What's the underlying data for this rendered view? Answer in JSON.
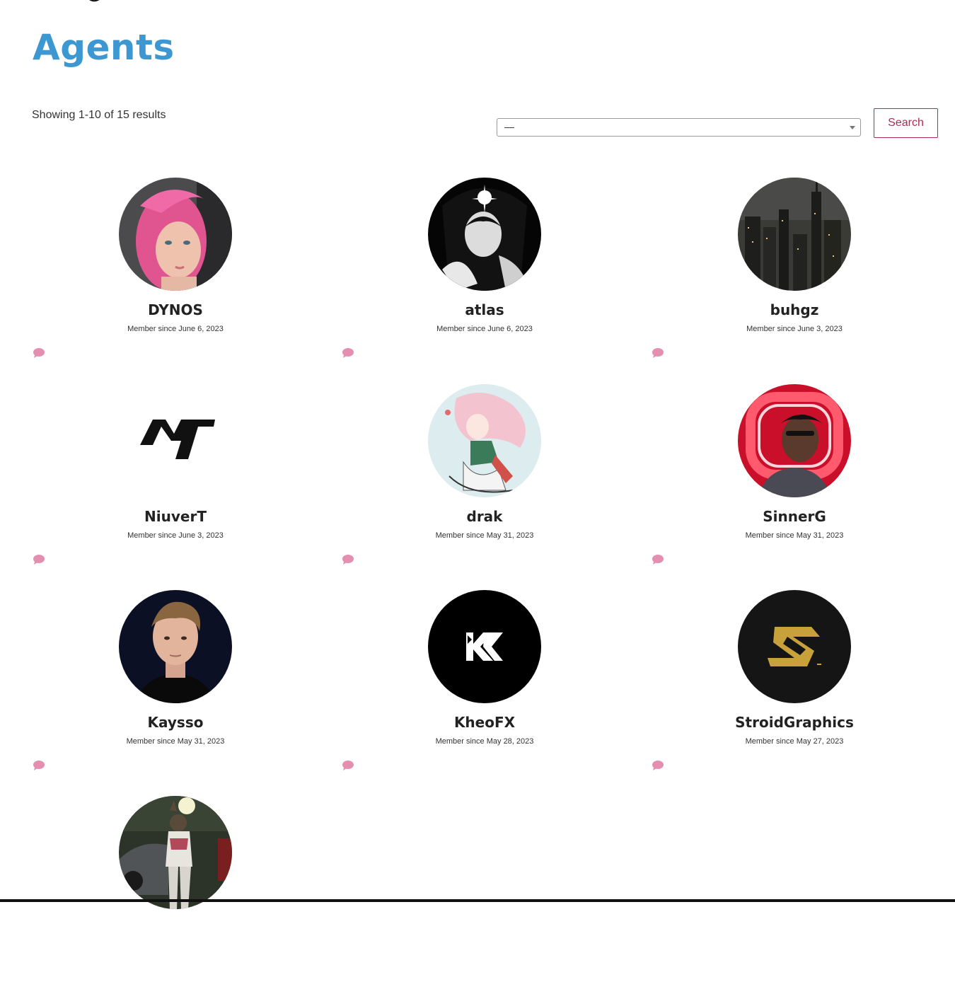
{
  "page": {
    "title": "Agents"
  },
  "results": {
    "summary": "Showing 1-10 of 15 results"
  },
  "filter": {
    "selected": "—"
  },
  "search": {
    "label": "Search"
  },
  "colors": {
    "title": "#3d97d0",
    "accent": "#b02a52",
    "message_icon": "#e58fb0"
  },
  "agents": [
    {
      "name": "DYNOS",
      "member_since": "Member since June 6, 2023",
      "avatar": "pink-hair-portrait"
    },
    {
      "name": "atlas",
      "member_since": "Member since June 6, 2023",
      "avatar": "black-white-art"
    },
    {
      "name": "buhgz",
      "member_since": "Member since June 3, 2023",
      "avatar": "night-city-skyline"
    },
    {
      "name": "NiuverT",
      "member_since": "Member since June 3, 2023",
      "avatar": "nt-logo"
    },
    {
      "name": "drak",
      "member_since": "Member since May 31, 2023",
      "avatar": "anime-illustration"
    },
    {
      "name": "SinnerG",
      "member_since": "Member since May 31, 2023",
      "avatar": "neon-red-portrait"
    },
    {
      "name": "Kaysso",
      "member_since": "Member since May 31, 2023",
      "avatar": "young-man-portrait"
    },
    {
      "name": "KheoFX",
      "member_since": "Member since May 28, 2023",
      "avatar": "k-logo"
    },
    {
      "name": "StroidGraphics",
      "member_since": "Member since May 27, 2023",
      "avatar": "s-gold-logo"
    },
    {
      "name": "",
      "member_since": "",
      "avatar": "outdoor-photo"
    }
  ]
}
